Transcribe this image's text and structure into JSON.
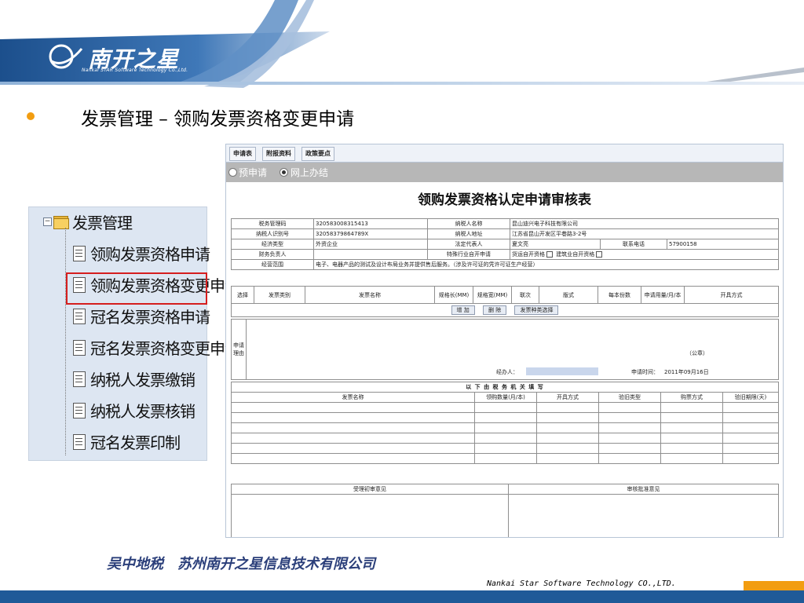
{
  "brand": {
    "logo_text": "南开之星",
    "logo_subtitle": "Nankai STAR Software Technology Co.,Ltd."
  },
  "slide": {
    "title": "发票管理 – 领购发票资格变更申请"
  },
  "tree": {
    "root_label": "发票管理",
    "items": [
      {
        "label": "领购发票资格申请"
      },
      {
        "label": "领购发票资格变更申请",
        "selected": true
      },
      {
        "label": "冠名发票资格申请"
      },
      {
        "label": "冠名发票资格变更申请"
      },
      {
        "label": "纳税人发票缴销"
      },
      {
        "label": "纳税人发票核销"
      },
      {
        "label": "冠名发票印制"
      }
    ]
  },
  "form": {
    "tabs": [
      "申请表",
      "附报资料",
      "政策要点"
    ],
    "modes": {
      "option_1": "预申请",
      "option_2": "网上办结",
      "selected": "网上办结"
    },
    "title": "领购发票资格认定申请审核表",
    "info": {
      "tax_code_label": "税务管理码",
      "tax_code": "320583008315413",
      "taxpayer_name_label": "纳税人名称",
      "taxpayer_name": "昆山迪兴电子科技有限公司",
      "taxpayer_id_label": "纳税人识别号",
      "taxpayer_id": "320583798647​89X",
      "taxpayer_addr_label": "纳税人地址",
      "taxpayer_addr": "江苏省昆山开发区平巷路3-2号",
      "econ_type_label": "经济类型",
      "econ_type": "外资企业",
      "legal_rep_label": "法定代表人",
      "legal_rep": "夏文亮",
      "phone_label": "联系电话",
      "phone": "57900158",
      "finance_label": "财务负责人",
      "finance": "",
      "special_label": "特殊行业自开申请",
      "special_opt1": "货运自开资格",
      "special_opt2": "建筑业自开资格",
      "scope_label": "经营范围",
      "scope": "电子、电器产品的测试及设计布局业务并提供售后服务。（涉及许可证的凭许可证生产经营）"
    },
    "invoice_headers": [
      "选择",
      "发票类别",
      "发票名称",
      "规格长(MM)",
      "规格宽(MM)",
      "联次",
      "版式",
      "每本份数",
      "申请用量/月/本",
      "开具方式"
    ],
    "buttons": {
      "add": "增 加",
      "delete": "删 除",
      "select": "发票种类选择"
    },
    "reason": {
      "label": "申请理由",
      "seal": "（公章）",
      "handler_label": "经办人：",
      "date_label": "申请时间：",
      "date": "2011年09月16日"
    },
    "tax_section_title": "以 下 由 税 务 机 关 填 写",
    "tax_headers": [
      "发票名称",
      "领购数量(月/本)",
      "开具方式",
      "验旧类型",
      "购票方式",
      "验旧期限(天)"
    ],
    "opinion_initial": "受理初审意见",
    "opinion_approve": "审核批准意见"
  },
  "footer": {
    "company_cn": "吴中地税　苏州南开之星信息技术有限公司",
    "company_en": "Nankai Star Software Technology CO.,LTD."
  },
  "colors": {
    "accent_orange": "#f29d11",
    "brand_blue": "#1f5a98",
    "highlight_red": "#d51e1e"
  }
}
